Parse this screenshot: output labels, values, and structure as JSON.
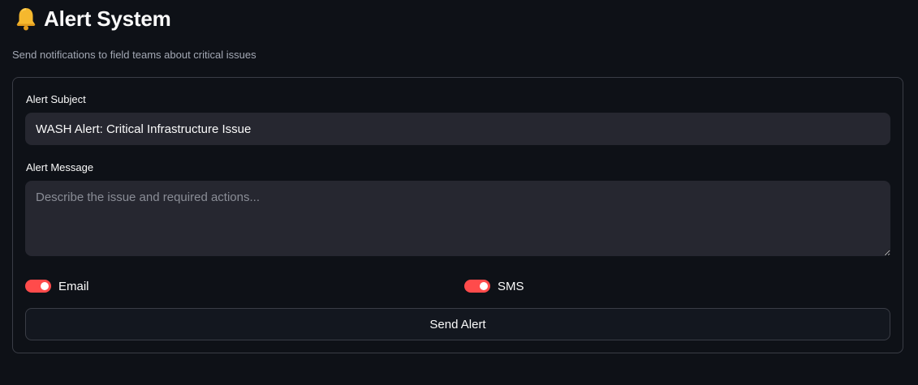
{
  "header": {
    "icon": "bell-icon",
    "title": "Alert System",
    "subtitle": "Send notifications to field teams about critical issues"
  },
  "form": {
    "subject_label": "Alert Subject",
    "subject_value": "WASH Alert: Critical Infrastructure Issue",
    "message_label": "Alert Message",
    "message_value": "",
    "message_placeholder": "Describe the issue and required actions...",
    "toggles": {
      "email": {
        "label": "Email",
        "checked": true
      },
      "sms": {
        "label": "SMS",
        "checked": true
      }
    },
    "send_label": "Send Alert"
  },
  "colors": {
    "background": "#0e1117",
    "input_bg": "#262730",
    "toggle_on": "#ff4b4b",
    "bell": "#f5b82e"
  }
}
